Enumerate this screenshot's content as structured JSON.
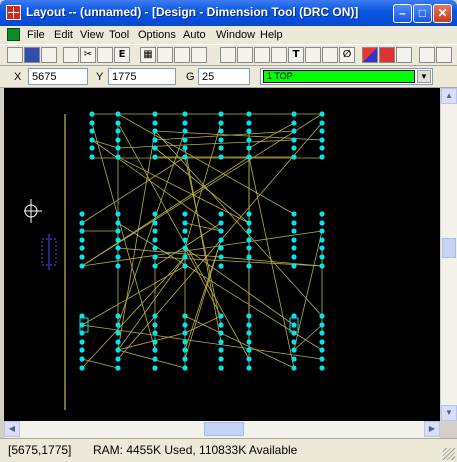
{
  "window": {
    "title": "Layout -- (unnamed) - [Design - Dimension Tool (DRC ON)]",
    "minimize_glyph": "–",
    "maximize_glyph": "□",
    "close_glyph": "✕"
  },
  "menu": {
    "items": [
      "File",
      "Edit",
      "View",
      "Tool",
      "Options",
      "Auto",
      "Window",
      "Help"
    ]
  },
  "toolbar": {
    "text_tool_glyph": "T",
    "edit_glyph": "E"
  },
  "coords": {
    "x_label": "X",
    "x_value": "5675",
    "y_label": "Y",
    "y_value": "1775",
    "g_label": "G",
    "g_value": "25",
    "layer": "1  TOP",
    "layer_color": "#00ff00"
  },
  "canvas": {
    "background": "#000000",
    "pad_color": "#00e5ee",
    "trace_color": "#b8b040",
    "board_edge_color": "#e6e650",
    "component_color": "#3a5bff"
  },
  "statusbar": {
    "position": "[5675,1775]",
    "ram": "RAM: 4455K Used, 110833K Available"
  }
}
